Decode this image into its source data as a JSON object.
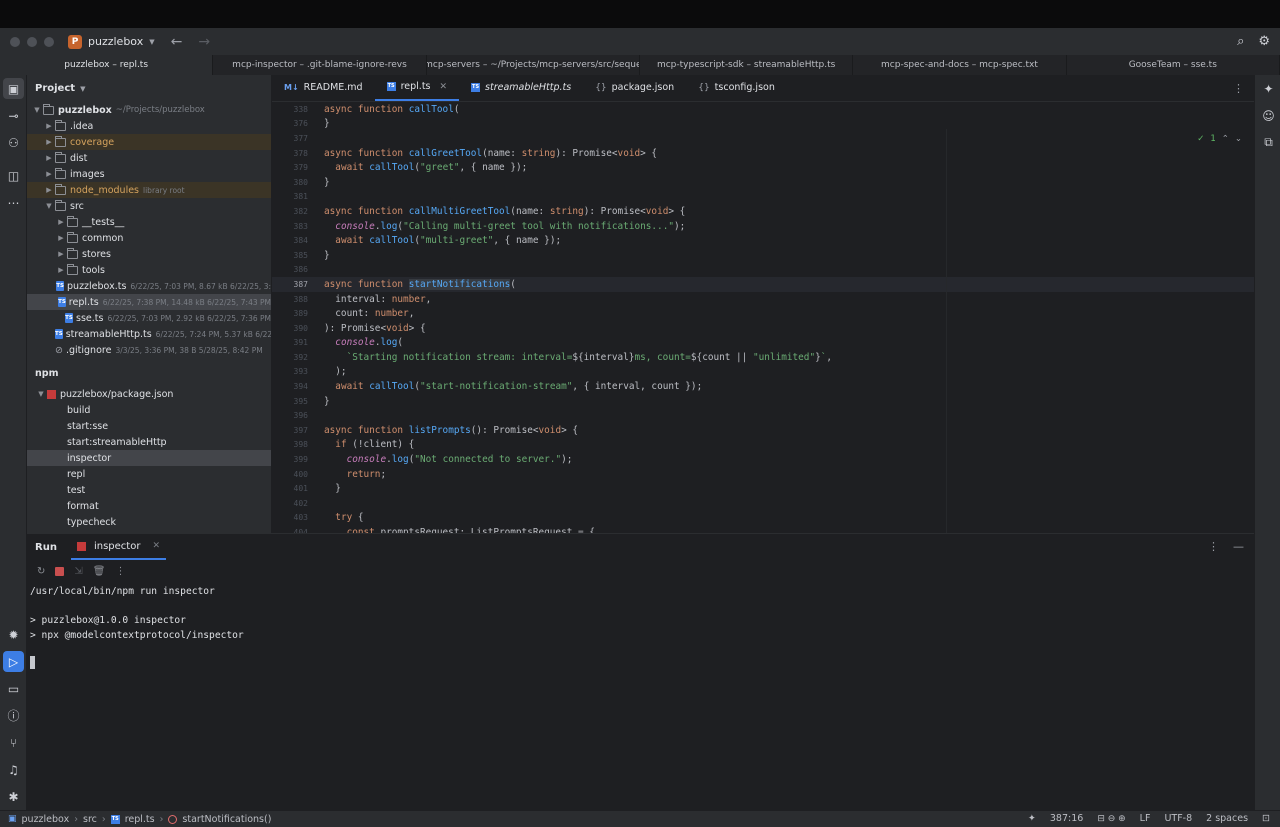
{
  "window": {
    "project_badge": "P",
    "project_name": "puzzlebox",
    "back_glyph": "←",
    "forward_glyph": "→",
    "search_glyph": "⌕",
    "settings_glyph": "⚙"
  },
  "window_tabs": [
    {
      "label": "puzzlebox – repl.ts",
      "active": true
    },
    {
      "label": "mcp-inspector – .git-blame-ignore-revs",
      "active": false
    },
    {
      "label": "mcp-servers – ~/Projects/mcp-servers/src/seque",
      "active": false
    },
    {
      "label": "mcp-typescript-sdk – streamableHttp.ts",
      "active": false
    },
    {
      "label": "mcp-spec-and-docs – mcp-spec.txt",
      "active": false
    },
    {
      "label": "GooseTeam – sse.ts",
      "active": false
    }
  ],
  "project_panel": {
    "title": "Project",
    "root": {
      "name": "puzzlebox",
      "path": "~/Projects/puzzlebox"
    },
    "items": [
      {
        "name": ".idea",
        "kind": "folder",
        "depth": 1,
        "excluded": false,
        "meta": ""
      },
      {
        "name": "coverage",
        "kind": "folder",
        "depth": 1,
        "excluded": true,
        "meta": ""
      },
      {
        "name": "dist",
        "kind": "folder",
        "depth": 1,
        "excluded": false,
        "meta": ""
      },
      {
        "name": "images",
        "kind": "folder",
        "depth": 1,
        "excluded": false,
        "meta": ""
      },
      {
        "name": "node_modules",
        "kind": "folder",
        "depth": 1,
        "excluded": true,
        "meta": "library root"
      },
      {
        "name": "src",
        "kind": "folder-open",
        "depth": 1,
        "excluded": false,
        "meta": ""
      },
      {
        "name": "__tests__",
        "kind": "folder",
        "depth": 2,
        "excluded": false,
        "meta": ""
      },
      {
        "name": "common",
        "kind": "folder",
        "depth": 2,
        "excluded": false,
        "meta": ""
      },
      {
        "name": "stores",
        "kind": "folder",
        "depth": 2,
        "excluded": false,
        "meta": ""
      },
      {
        "name": "tools",
        "kind": "folder",
        "depth": 2,
        "excluded": false,
        "meta": ""
      },
      {
        "name": "puzzlebox.ts",
        "kind": "ts",
        "depth": 2,
        "excluded": false,
        "meta": "6/22/25, 7:03 PM, 8.67 kB 6/22/25, 3:"
      },
      {
        "name": "repl.ts",
        "kind": "ts",
        "depth": 2,
        "excluded": false,
        "selected": true,
        "meta": "6/22/25, 7:38 PM, 14.48 kB 6/22/25, 7:43 PM"
      },
      {
        "name": "sse.ts",
        "kind": "ts",
        "depth": 2,
        "excluded": false,
        "meta": "6/22/25, 7:03 PM, 2.92 kB 6/22/25, 7:36 PM"
      },
      {
        "name": "streamableHttp.ts",
        "kind": "ts",
        "depth": 2,
        "excluded": false,
        "meta": "6/22/25, 7:24 PM, 5.37 kB 6/22/25, 7:36 PM"
      },
      {
        "name": ".gitignore",
        "kind": "ignore",
        "depth": 1,
        "excluded": false,
        "meta": "3/3/25, 3:36 PM, 38 B 5/28/25, 8:42 PM"
      }
    ]
  },
  "npm_panel": {
    "title": "npm",
    "package": "puzzlebox/package.json",
    "scripts": [
      "build",
      "start:sse",
      "start:streamableHttp",
      "inspector",
      "repl",
      "test",
      "format",
      "typecheck"
    ],
    "selected": "inspector"
  },
  "editor_tabs": [
    {
      "label": "README.md",
      "icon": "M↓",
      "italic": false,
      "active": false,
      "closable": false
    },
    {
      "label": "repl.ts",
      "icon": "TS",
      "italic": false,
      "active": true,
      "closable": true
    },
    {
      "label": "streamableHttp.ts",
      "icon": "TS",
      "italic": true,
      "active": false,
      "closable": false
    },
    {
      "label": "package.json",
      "icon": "{}",
      "italic": false,
      "active": false,
      "closable": false
    },
    {
      "label": "tsconfig.json",
      "icon": "{}",
      "italic": false,
      "active": false,
      "closable": false
    }
  ],
  "inspection": {
    "count": "1"
  },
  "code_lines": [
    {
      "n": "338",
      "html": "<span class='kw'>async function</span> <span class='fn'>callTool</span>("
    },
    {
      "n": "376",
      "html": "}"
    },
    {
      "n": "377",
      "html": ""
    },
    {
      "n": "378",
      "html": "<span class='kw'>async function</span> <span class='fn'>callGreetTool</span>(name: <span class='ty'>string</span>): Promise&lt;<span class='ty'>void</span>&gt; {"
    },
    {
      "n": "379",
      "html": "  <span class='kw'>await</span> <span class='fn'>callTool</span>(<span class='str'>\"greet\"</span>, { name });"
    },
    {
      "n": "380",
      "html": "}"
    },
    {
      "n": "381",
      "html": ""
    },
    {
      "n": "382",
      "html": "<span class='kw'>async function</span> <span class='fn'>callMultiGreetTool</span>(name: <span class='ty'>string</span>): Promise&lt;<span class='ty'>void</span>&gt; {"
    },
    {
      "n": "383",
      "html": "  <span class='pr'>console</span>.<span class='fn'>log</span>(<span class='str'>\"Calling multi-greet tool with notifications...\"</span>);"
    },
    {
      "n": "384",
      "html": "  <span class='kw'>await</span> <span class='fn'>callTool</span>(<span class='str'>\"multi-greet\"</span>, { name });"
    },
    {
      "n": "385",
      "html": "}"
    },
    {
      "n": "386",
      "html": ""
    },
    {
      "n": "387",
      "html": "<span class='kw'>async function</span> <span class='fn hl'>startNotifications</span>(",
      "current": true
    },
    {
      "n": "388",
      "html": "  interval: <span class='ty'>number</span>,"
    },
    {
      "n": "389",
      "html": "  count: <span class='ty'>number</span>,"
    },
    {
      "n": "390",
      "html": "): Promise&lt;<span class='ty'>void</span>&gt; {"
    },
    {
      "n": "391",
      "html": "  <span class='pr'>console</span>.<span class='fn'>log</span>("
    },
    {
      "n": "392",
      "html": "    <span class='str'>`Starting notification stream: interval=</span>${interval}<span class='str'>ms, count=</span>${count || <span class='str'>\"unlimited\"</span>}<span class='str'>`</span>,"
    },
    {
      "n": "393",
      "html": "  );"
    },
    {
      "n": "394",
      "html": "  <span class='kw'>await</span> <span class='fn'>callTool</span>(<span class='str'>\"start-notification-stream\"</span>, { interval, count });"
    },
    {
      "n": "395",
      "html": "}"
    },
    {
      "n": "396",
      "html": ""
    },
    {
      "n": "397",
      "html": "<span class='kw'>async function</span> <span class='fn'>listPrompts</span>(): Promise&lt;<span class='ty'>void</span>&gt; {"
    },
    {
      "n": "398",
      "html": "  <span class='kw'>if</span> (!client) {"
    },
    {
      "n": "399",
      "html": "    <span class='pr'>console</span>.<span class='fn'>log</span>(<span class='str'>\"Not connected to server.\"</span>);"
    },
    {
      "n": "400",
      "html": "    <span class='kw'>return</span>;"
    },
    {
      "n": "401",
      "html": "  }"
    },
    {
      "n": "402",
      "html": ""
    },
    {
      "n": "403",
      "html": "  <span class='kw'>try</span> {"
    },
    {
      "n": "404",
      "html": "    <span class='kw'>const</span> promptsRequest: ListPromptsRequest = {"
    }
  ],
  "run_panel": {
    "title": "Run",
    "tab_label": "inspector",
    "console_lines": [
      "/usr/local/bin/npm run inspector",
      "",
      "> puzzlebox@1.0.0 inspector",
      "> npx @modelcontextprotocol/inspector"
    ]
  },
  "status_bar": {
    "breadcrumb": [
      "puzzlebox",
      "src",
      "repl.ts",
      "startNotifications()"
    ],
    "position": "387:16",
    "line_ending": "LF",
    "encoding": "UTF-8",
    "indent": "2 spaces"
  },
  "colors": {
    "accent": "#3d7ee5",
    "excluded_folder": "#d5a35e",
    "stop": "#c94f4f"
  }
}
